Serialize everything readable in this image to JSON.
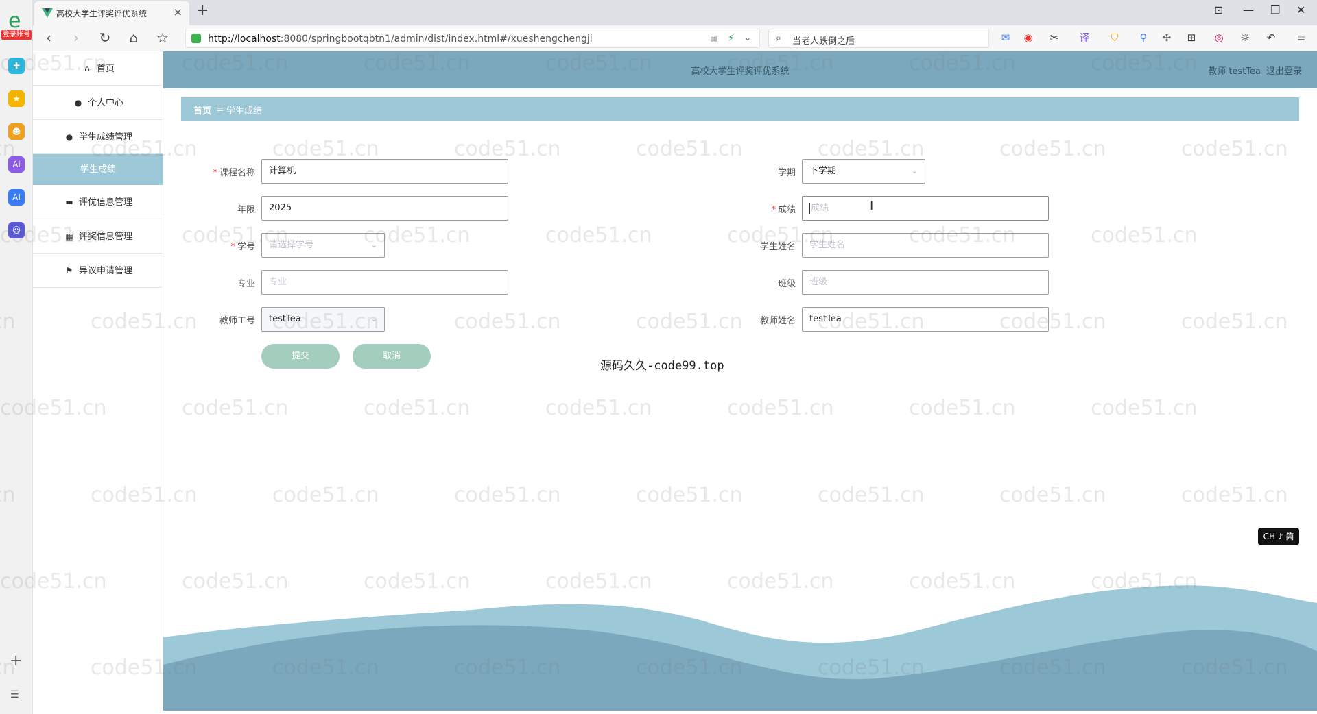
{
  "browser": {
    "tab_title": "高校大学生评奖评优系统",
    "url_host": "http://localhost",
    "url_rest": ":8080/springbootqbtn1/admin/dist/index.html#/xueshengchengji",
    "search_text": "当老人跌倒之后",
    "login_badge": "登录账号"
  },
  "app": {
    "system_title": "高校大学生评奖评优系统",
    "user_label": "教师 testTea",
    "logout_label": "退出登录"
  },
  "sidebar": {
    "items": [
      {
        "label": "首页",
        "icon": "home-icon"
      },
      {
        "label": "个人中心",
        "icon": "user-icon"
      },
      {
        "label": "学生成绩管理",
        "icon": "user-icon"
      },
      {
        "label": "学生成绩",
        "icon": "",
        "active": true
      },
      {
        "label": "评优信息管理",
        "icon": "briefcase-icon"
      },
      {
        "label": "评奖信息管理",
        "icon": "grid-icon"
      },
      {
        "label": "异议申请管理",
        "icon": "flag-icon"
      }
    ]
  },
  "breadcrumb": {
    "home": "首页",
    "separator": "☰",
    "current": "学生成绩"
  },
  "form": {
    "course_name": {
      "label": "课程名称",
      "value": "计算机",
      "required": true
    },
    "semester": {
      "label": "学期",
      "value": "下学期"
    },
    "year": {
      "label": "年限",
      "value": "2025"
    },
    "score": {
      "label": "成绩",
      "placeholder": "成绩",
      "required": true
    },
    "student_id": {
      "label": "学号",
      "placeholder": "请选择学号",
      "required": true
    },
    "student_name": {
      "label": "学生姓名",
      "placeholder": "学生姓名"
    },
    "major": {
      "label": "专业",
      "placeholder": "专业"
    },
    "class": {
      "label": "班级",
      "placeholder": "班级"
    },
    "teacher_id": {
      "label": "教师工号",
      "value": "testTea"
    },
    "teacher_name": {
      "label": "教师姓名",
      "value": "testTea"
    },
    "submit_label": "提交",
    "cancel_label": "取消"
  },
  "overlay_text": "源码久久-code99.top",
  "ime_badge": "CH ♪ 简",
  "watermark": "code51.cn",
  "colors": {
    "header": "#7ba8bd",
    "accent": "#9cc8d8",
    "button": "#a3cdbc",
    "wave_light": "#9cc8d8",
    "wave_dark": "#7ba8bd"
  }
}
